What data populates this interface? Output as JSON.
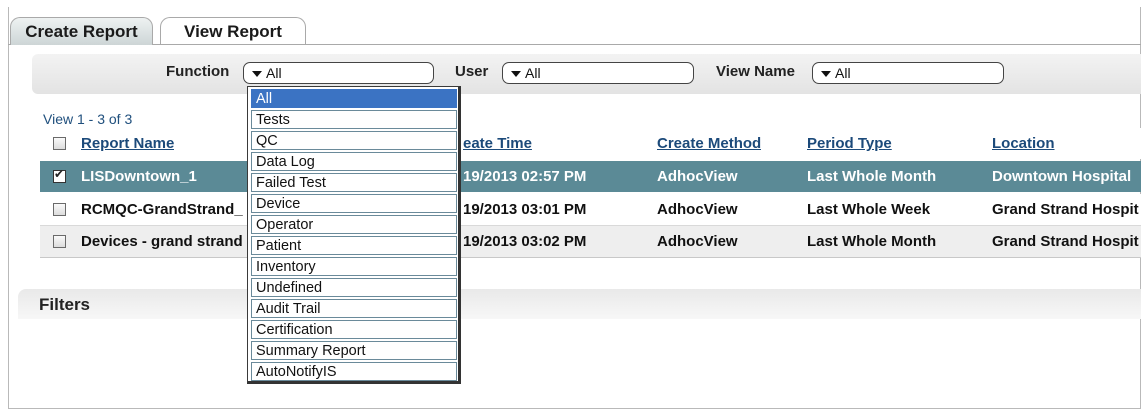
{
  "tabs": [
    {
      "label": "Create Report"
    },
    {
      "label": "View Report"
    }
  ],
  "filters_bar": {
    "function_label": "Function",
    "function_value": "All",
    "user_label": "User",
    "user_value": "All",
    "view_name_label": "View Name",
    "view_name_value": "All"
  },
  "function_dropdown": {
    "options": [
      "All",
      "Tests",
      "QC",
      "Data Log",
      "Failed Test",
      "Device",
      "Operator",
      "Patient",
      "Inventory",
      "Undefined",
      "Audit Trail",
      "Certification",
      "Summary Report",
      "AutoNotifyIS"
    ],
    "selected": "All"
  },
  "table": {
    "count_text": "View 1 - 3 of 3",
    "columns": [
      "Report Name",
      "eate Time",
      "Create Method",
      "Period Type",
      "Location"
    ],
    "rows": [
      {
        "checked": true,
        "name": "LISDowntown_1",
        "time": "19/2013 02:57 PM",
        "method": "AdhocView",
        "period": "Last Whole Month",
        "location": "Downtown Hospital"
      },
      {
        "checked": false,
        "name": "RCMQC-GrandStrand_",
        "time": "19/2013 03:01 PM",
        "method": "AdhocView",
        "period": "Last Whole Week",
        "location": "Grand Strand Hospit"
      },
      {
        "checked": false,
        "name": "Devices - grand strand",
        "time": "19/2013 03:02 PM",
        "method": "AdhocView",
        "period": "Last Whole Month",
        "location": "Grand Strand Hospit"
      }
    ]
  },
  "filters_section": {
    "title": "Filters"
  },
  "colors": {
    "selected_row": "#5b8a96",
    "dropdown_active": "#3b73c3",
    "header_link": "#1c4a7a"
  }
}
